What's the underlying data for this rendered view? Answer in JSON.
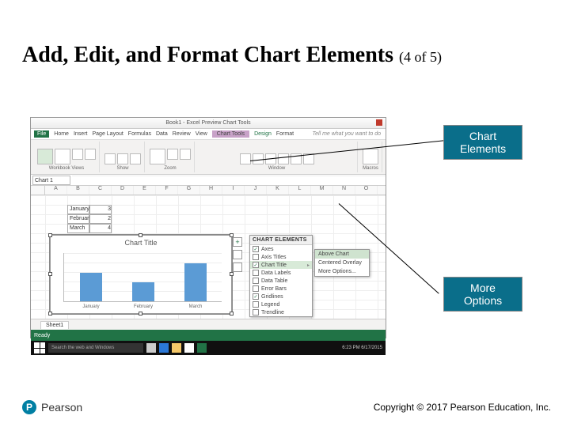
{
  "slide": {
    "title_main": "Add, Edit, and Format Chart Elements",
    "title_counter": "(4 of 5)"
  },
  "callouts": {
    "chart_elements": "Chart\nElements",
    "more_options": "More\nOptions"
  },
  "excel": {
    "titlebar_center": "Book1 - Excel Preview   Chart Tools",
    "tabs": {
      "file": "File",
      "home": "Home",
      "insert": "Insert",
      "page_layout": "Page Layout",
      "formulas": "Formulas",
      "data": "Data",
      "review": "Review",
      "view": "View",
      "chart_tools": "Chart Tools",
      "design": "Design",
      "format": "Format",
      "tell_me": "Tell me what you want to do"
    },
    "ribbon_groups": [
      "Workbook Views",
      "Show",
      "Zoom",
      "Window",
      "Macros"
    ],
    "namebox": "Chart 1",
    "columns": [
      "A",
      "B",
      "C",
      "D",
      "E",
      "F",
      "G",
      "H",
      "I",
      "J",
      "K",
      "L",
      "M",
      "N",
      "O"
    ],
    "data_rows": [
      {
        "label": "January",
        "value": "3"
      },
      {
        "label": "February",
        "value": "2"
      },
      {
        "label": "March",
        "value": "4"
      }
    ],
    "chart_title": "Chart Title",
    "chart_xlabels": [
      "January",
      "February",
      "March"
    ],
    "chart_elements_flyout": {
      "header": "CHART ELEMENTS",
      "options": [
        {
          "label": "Axes",
          "checked": true
        },
        {
          "label": "Axis Titles",
          "checked": false
        },
        {
          "label": "Chart Title",
          "checked": true,
          "arrow": true,
          "highlight": true
        },
        {
          "label": "Data Labels",
          "checked": false
        },
        {
          "label": "Data Table",
          "checked": false
        },
        {
          "label": "Error Bars",
          "checked": false
        },
        {
          "label": "Gridlines",
          "checked": true
        },
        {
          "label": "Legend",
          "checked": false
        },
        {
          "label": "Trendline",
          "checked": false
        }
      ]
    },
    "chart_title_submenu": [
      {
        "label": "Above Chart",
        "highlight": true
      },
      {
        "label": "Centered Overlay"
      },
      {
        "label": "More Options..."
      }
    ],
    "sheet_tab": "Sheet1",
    "status_ready": "Ready",
    "taskbar_search_placeholder": "Search the web and Windows",
    "taskbar_clock": "6:23 PM\n6/17/2015"
  },
  "chart_data": {
    "type": "bar",
    "title": "Chart Title",
    "categories": [
      "January",
      "February",
      "March"
    ],
    "values": [
      3,
      2,
      4
    ],
    "ylim": [
      0,
      5
    ],
    "xlabel": "",
    "ylabel": ""
  },
  "footer": {
    "brand": "Pearson",
    "copyright": "Copyright © 2017 Pearson Education, Inc."
  }
}
